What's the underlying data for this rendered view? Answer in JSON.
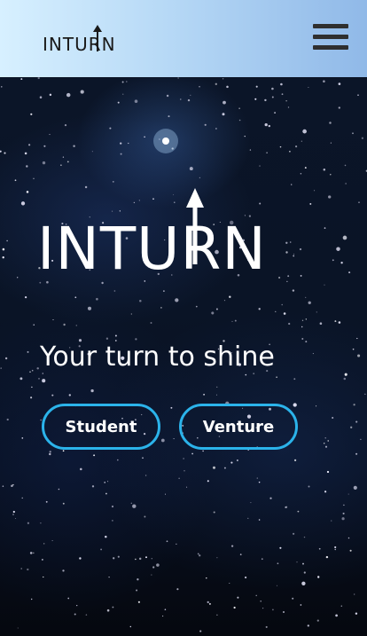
{
  "header": {
    "logo_text": "INTURN",
    "menu_icon": "hamburger-icon"
  },
  "hero": {
    "brand_text": "INTURN",
    "tagline": "Your turn to shine",
    "buttons": [
      {
        "label": "Student"
      },
      {
        "label": "Venture"
      }
    ]
  },
  "colors": {
    "header_gradient_start": "#d7f0ff",
    "header_gradient_end": "#90b9e8",
    "button_border": "#2bb3ea",
    "text_light": "#ffffff",
    "menu_icon": "#2f2f2f"
  }
}
